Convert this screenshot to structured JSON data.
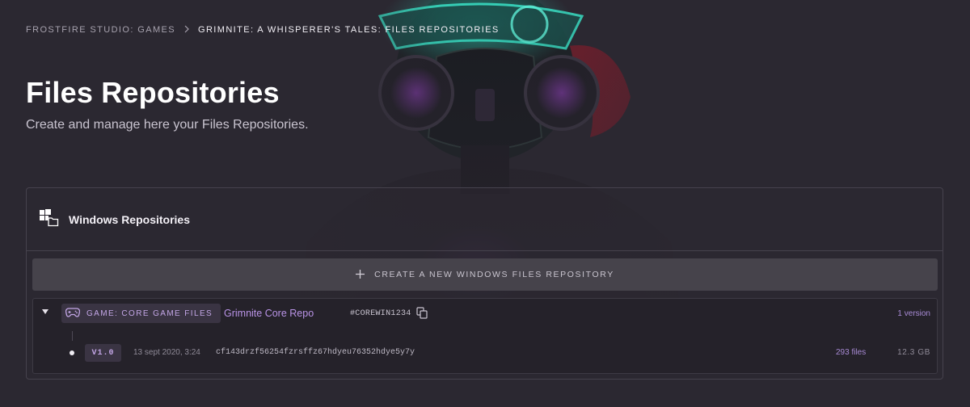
{
  "breadcrumb": {
    "items": [
      "FROSTFIRE STUDIO: GAMES",
      "GRIMNITE: A WHISPERER'S TALES: FILES REPOSITORIES"
    ],
    "separator": ">"
  },
  "page": {
    "title": "Files Repositories",
    "subtitle": "Create and manage here your Files Repositories."
  },
  "section": {
    "title": "Windows Repositories",
    "icon": "windows-icon",
    "create_label": "CREATE A NEW WINDOWS FILES REPOSITORY"
  },
  "repositories": [
    {
      "tag": "GAME: CORE GAME FILES",
      "name": "Grimnite Core Repo",
      "id": "#COREWIN1234",
      "version_count": "1 version",
      "versions": [
        {
          "label": "V1.0",
          "date": "13 sept 2020, 3:24",
          "hash": "cf143drzf56254fzrsffz67hdyeu76352hdye5y7y",
          "files": "293 files",
          "size": "12.3 GB"
        }
      ]
    }
  ],
  "colors": {
    "background": "#2b2831",
    "accent": "#b993e6",
    "panel_border": "#46424d"
  }
}
